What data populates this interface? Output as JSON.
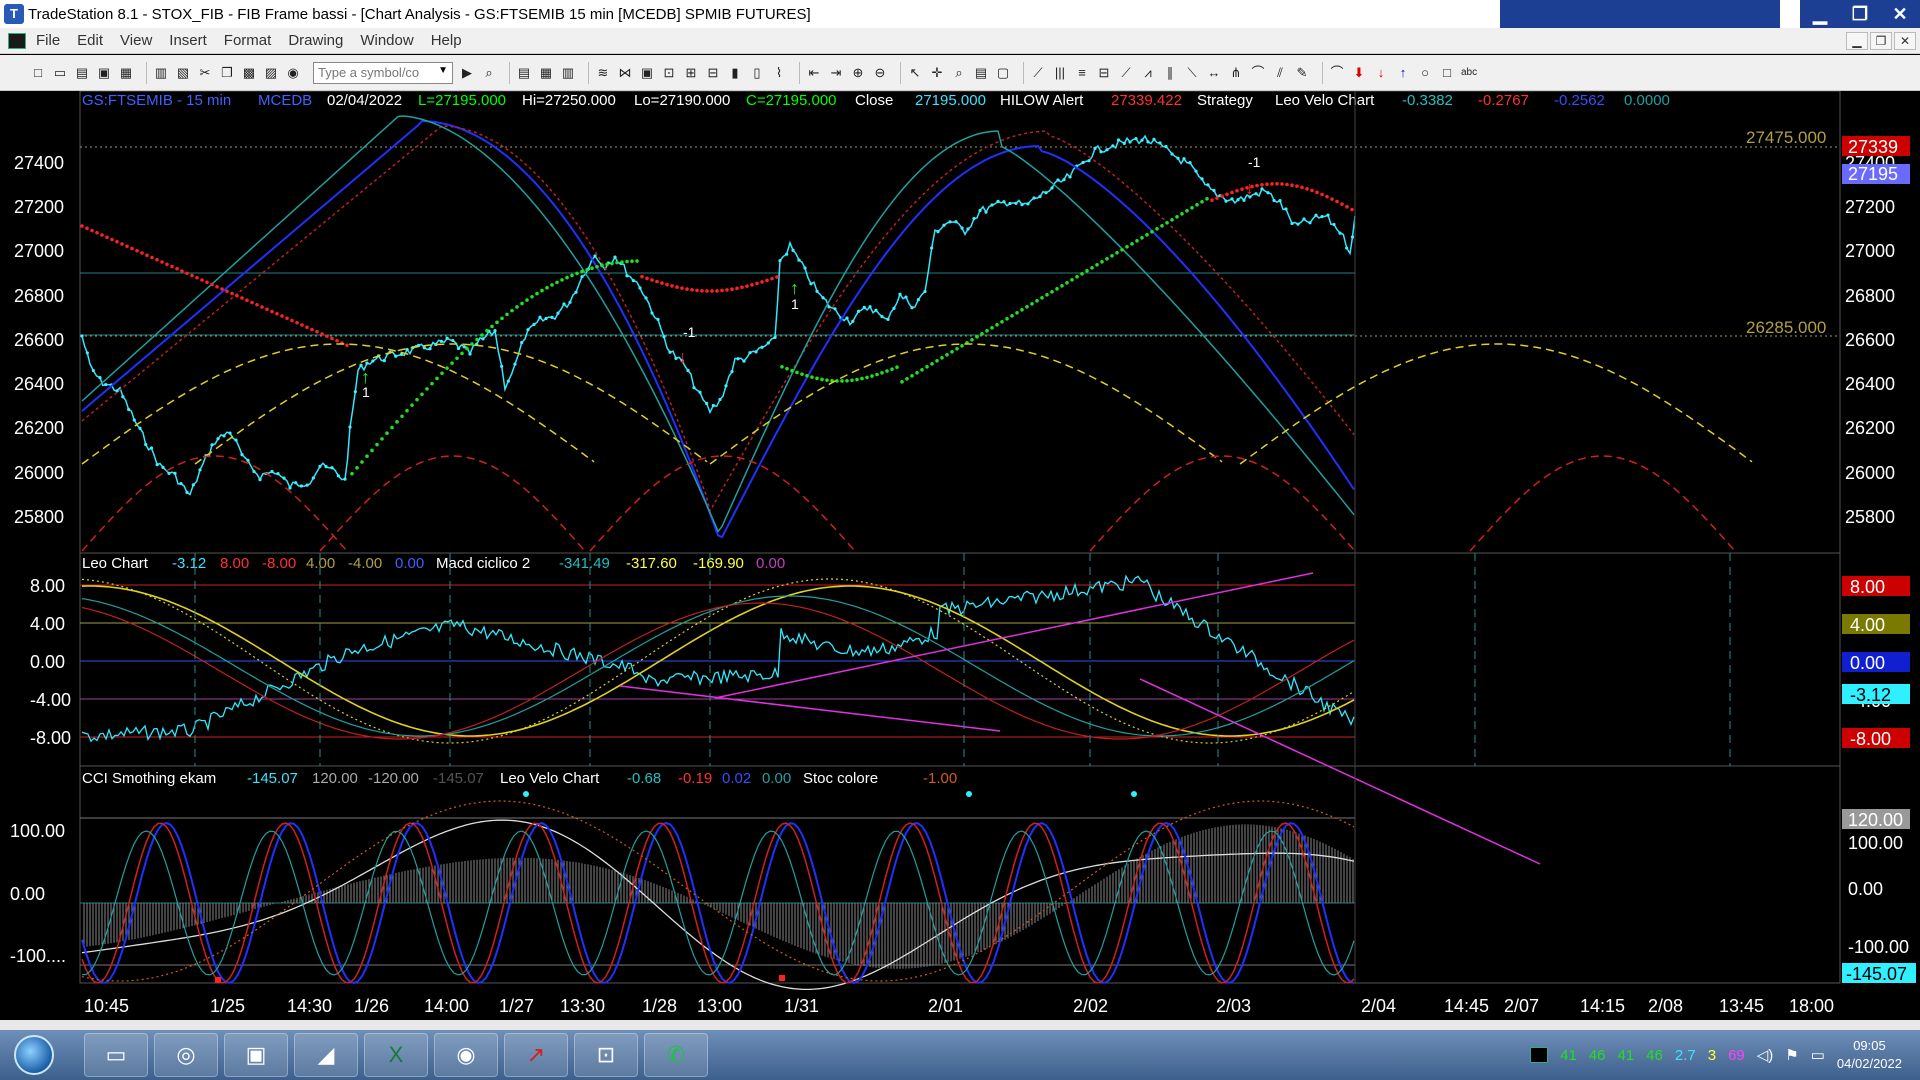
{
  "window": {
    "title": "TradeStation 8.1 - STOX_FIB - FIB Frame bassi - [Chart Analysis - GS:FTSEMIB  15 min  [MCEDB] SPMIB FUTURES]",
    "controls": [
      "▁",
      "❐",
      "✕"
    ]
  },
  "menu": {
    "items": [
      "File",
      "Edit",
      "View",
      "Insert",
      "Format",
      "Drawing",
      "Window",
      "Help"
    ],
    "mdi_controls": [
      "▁",
      "❐",
      "✕"
    ]
  },
  "toolbar": {
    "symbol_placeholder": "Type a symbol/co"
  },
  "status_line": {
    "symbol": "GS:FTSEMIB - 15 min",
    "source": "MCEDB",
    "date": "02/04/2022",
    "last": "L=27195.000",
    "hi": "Hi=27250.000",
    "lo": "Lo=27190.000",
    "close_eq": "C=27195.000",
    "close_label": "Close",
    "close_val": "27195.000",
    "hilow_label": "HILOW Alert",
    "hilow_val": "27339.422",
    "strategy": "Strategy",
    "leo_velo": "Leo Velo Chart",
    "lv1": "-0.3382",
    "lv2": "-0.2767",
    "lv3": "-0.2562",
    "lv4": "0.0000"
  },
  "price_panel": {
    "top_level": "27475.000",
    "low_level": "26285.000",
    "axis_ticks": [
      "27400",
      "27200",
      "27000",
      "26800",
      "26600",
      "26400",
      "26200",
      "26000",
      "25800"
    ],
    "left_ticks": [
      "27400",
      "27200",
      "27000",
      "26800",
      "26600",
      "26400",
      "26200",
      "26000",
      "25800"
    ],
    "price_tags": {
      "hilow": "27339",
      "last": "27195"
    },
    "signals": [
      "1",
      "-1",
      "1",
      "-1"
    ]
  },
  "macd_panel": {
    "label": "Leo Chart",
    "v1": "-3.12",
    "v2": "8.00",
    "v3": "-8.00",
    "v4": "4.00",
    "v5": "-4.00",
    "v6": "0.00",
    "macd_label": "Macd ciclico 2",
    "m1": "-341.49",
    "m2": "-317.60",
    "m3": "-169.90",
    "m4": "0.00",
    "left_ticks": [
      "8.00",
      "4.00",
      "0.00",
      "-4.00",
      "-8.00"
    ],
    "tags": {
      "t8": "8.00",
      "t4": "4.00",
      "t0": "0.00",
      "tcur": "-3.12",
      "tm4": "-4.00",
      "tm8": "-8.00"
    }
  },
  "cci_panel": {
    "label": "CCI Smothing ekam",
    "c1": "-145.07",
    "c2": "120.00",
    "c3": "-120.00",
    "c4": "-145.07",
    "leo_velo": "Leo Velo Chart",
    "l1": "-0.68",
    "l2": "-0.19",
    "l3": "0.02",
    "l4": "0.00",
    "stoc": "Stoc colore",
    "s1": "-1.00",
    "left_ticks": [
      "100.00",
      "0.00",
      "-100...."
    ],
    "tags": {
      "t120": "120.00",
      "t100": "100.00",
      "t0": "0.00",
      "tm100": "-100.00",
      "tcur": "-145.07"
    }
  },
  "time_axis": [
    "10:45",
    "1/25",
    "14:30",
    "1/26",
    "14:00",
    "1/27",
    "13:30",
    "1/28",
    "13:00",
    "1/31",
    "2/01",
    "2/02",
    "2/03",
    "2/04",
    "14:45",
    "2/07",
    "14:15",
    "2/08",
    "13:45",
    "18:00"
  ],
  "taskbar": {
    "tray_numbers": [
      "41",
      "46",
      "41",
      "46",
      "2.7",
      "3",
      "69"
    ],
    "time": "09:05",
    "date": "04/02/2022"
  }
}
